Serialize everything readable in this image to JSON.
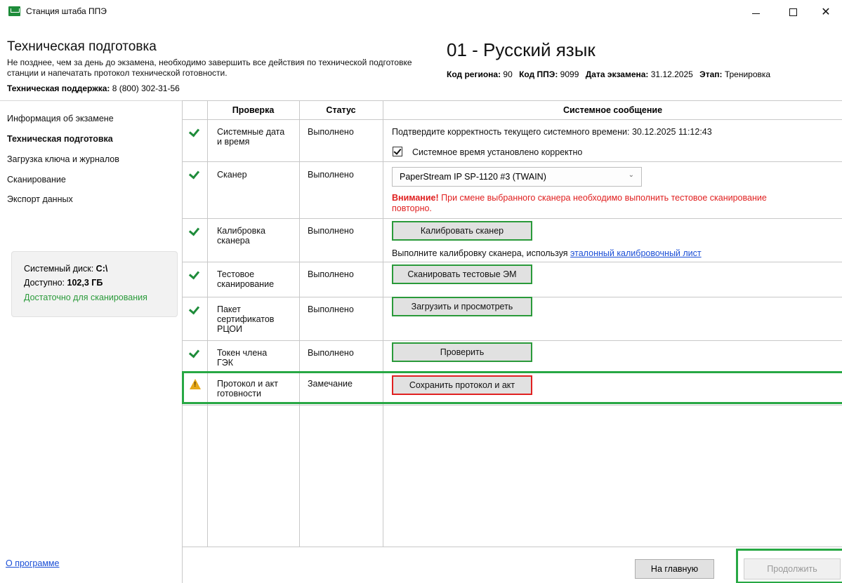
{
  "window": {
    "title": "Станция штаба ППЭ",
    "minimize": "",
    "maximize": "",
    "close": "✕"
  },
  "header": {
    "title": "Техническая подготовка",
    "description": "Не позднее, чем за день до экзамена, необходимо завершить все действия по технической подготовке станции и напечатать протокол технической готовности.",
    "support_label": "Техническая поддержка:",
    "support_phone": " 8 (800) 302-31-56",
    "subject": "01 - Русский язык",
    "region_label": "Код региона:",
    "region_value": " 90",
    "ppe_label": "Код ППЭ:",
    "ppe_value": " 9099",
    "date_label": "Дата экзамена:",
    "date_value": " 31.12.2025",
    "stage_label": "Этап:",
    "stage_value": " Тренировка"
  },
  "nav": {
    "items": [
      {
        "label": "Информация об экзамене"
      },
      {
        "label": "Техническая подготовка"
      },
      {
        "label": "Загрузка ключа и журналов"
      },
      {
        "label": "Сканирование"
      },
      {
        "label": "Экспорт данных"
      }
    ],
    "active_index": 1,
    "disk": {
      "label": "Системный диск:",
      "value": " C:\\",
      "free_label": "Доступно:",
      "free_value": " 102,3 ГБ",
      "status": "Достаточно для сканирования"
    },
    "about": "О программе"
  },
  "table": {
    "headers": {
      "check": "Проверка",
      "status": "Статус",
      "message": "Системное сообщение"
    },
    "rows": [
      {
        "icon": "check",
        "check": "Системные дата и время",
        "status": "Выполнено"
      },
      {
        "icon": "check",
        "check": "Сканер",
        "status": "Выполнено"
      },
      {
        "icon": "check",
        "check": "Калибровка сканера",
        "status": "Выполнено"
      },
      {
        "icon": "check",
        "check": "Тестовое сканирование",
        "status": "Выполнено"
      },
      {
        "icon": "check",
        "check": "Пакет сертификатов РЦОИ",
        "status": "Выполнено"
      },
      {
        "icon": "check",
        "check": "Токен члена ГЭК",
        "status": "Выполнено"
      },
      {
        "icon": "warning",
        "check": "Протокол и акт готовности",
        "status": "Замечание"
      }
    ],
    "time_message": "Подтвердите корректность текущего системного времени: 30.12.2025 11:12:43",
    "time_checkbox_label": "Системное время установлено корректно",
    "time_checkbox_checked": true,
    "scanner_select_value": "PaperStream IP SP-1120 #3 (TWAIN)",
    "scanner_warning_bold": "Внимание!",
    "scanner_warning_text": " При смене выбранного сканера необходимо выполнить тестовое сканирование повторно.",
    "calibrate_button": "Калибровать сканер",
    "calibrate_text": "Выполните калибровку сканера, используя ",
    "calibrate_link": "эталонный калибровочный лист",
    "test_scan_button": "Сканировать тестовые ЭМ",
    "certs_button": "Загрузить и просмотреть",
    "token_button": "Проверить",
    "protocol_button": "Сохранить протокол и акт"
  },
  "footer": {
    "home_button": "На главную",
    "continue_button": "Продолжить"
  },
  "colors": {
    "accent_green": "#27a844",
    "error_red": "#e02020",
    "link_blue": "#1a4ed6",
    "warning_yellow": "#e6a817"
  }
}
